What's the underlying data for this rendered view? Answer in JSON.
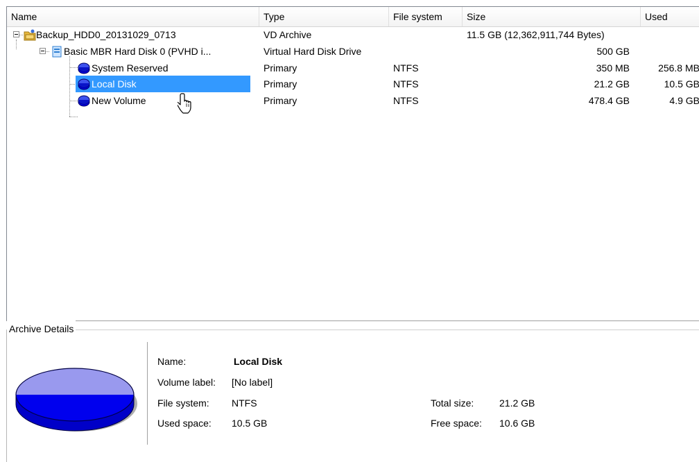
{
  "columns": {
    "name": "Name",
    "type": "Type",
    "file_system": "File system",
    "size": "Size",
    "used": "Used"
  },
  "rows": [
    {
      "name": "Backup_HDD0_20131029_0713",
      "type": "VD Archive",
      "fs": "",
      "size": "11.5 GB (12,362,911,744 Bytes)",
      "used": "",
      "icon": "archive-folder-icon",
      "level": 0
    },
    {
      "name": "Basic MBR Hard Disk 0 (PVHD i...",
      "type": "Virtual Hard Disk Drive",
      "fs": "",
      "size": "500 GB",
      "used": "",
      "icon": "hard-disk-icon",
      "level": 1
    },
    {
      "name": "System Reserved",
      "type": "Primary",
      "fs": "NTFS",
      "size": "350 MB",
      "used": "256.8 MB",
      "icon": "volume-icon",
      "level": 2
    },
    {
      "name": "Local Disk",
      "type": "Primary",
      "fs": "NTFS",
      "size": "21.2 GB",
      "used": "10.5 GB",
      "icon": "volume-icon",
      "level": 2,
      "selected": true
    },
    {
      "name": "New Volume",
      "type": "Primary",
      "fs": "NTFS",
      "size": "478.4 GB",
      "used": "4.9 GB",
      "icon": "volume-icon",
      "level": 2
    }
  ],
  "details": {
    "title": "Archive Details",
    "name_label": "Name:",
    "name_value": "Local Disk",
    "volume_label_label": "Volume label:",
    "volume_label_value": "[No label]",
    "file_system_label": "File system:",
    "file_system_value": "NTFS",
    "used_space_label": "Used space:",
    "used_space_value": "10.5 GB",
    "total_size_label": "Total size:",
    "total_size_value": "21.2 GB",
    "free_space_label": "Free space:",
    "free_space_value": "10.6 GB",
    "used_fraction": 0.5
  },
  "colors": {
    "selection": "#3399ff",
    "disk_used": "#0000ee",
    "disk_free": "#9999ee"
  }
}
